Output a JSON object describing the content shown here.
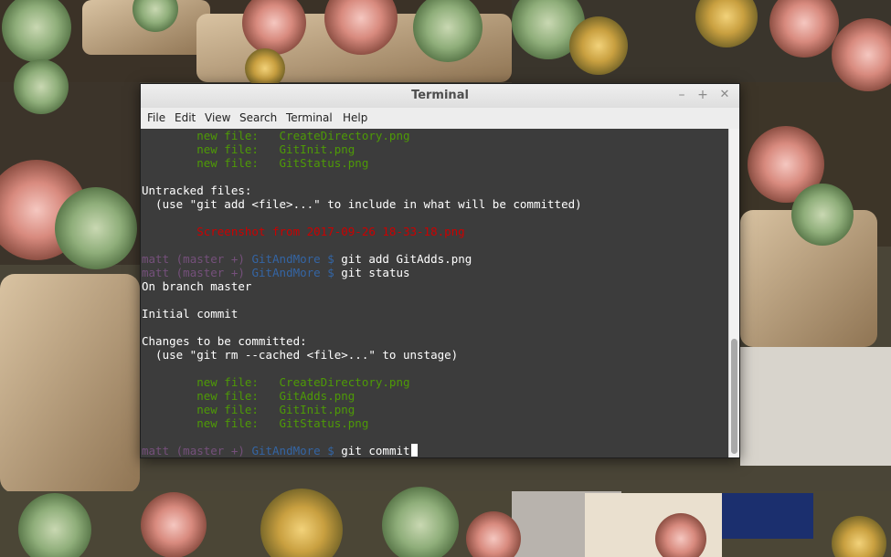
{
  "window": {
    "title": "Terminal",
    "controls": {
      "minimize": "–",
      "maximize": "+",
      "close": "✕"
    }
  },
  "menu": [
    "File",
    "Edit",
    "View",
    "Search",
    "Terminal",
    "Help"
  ],
  "terminal": {
    "lines": [
      [
        {
          "t": "        new file:   CreateDirectory.png",
          "c": "g"
        }
      ],
      [
        {
          "t": "        new file:   GitInit.png",
          "c": "g"
        }
      ],
      [
        {
          "t": "        new file:   GitStatus.png",
          "c": "g"
        }
      ],
      [
        {
          "t": "",
          "c": "w"
        }
      ],
      [
        {
          "t": "Untracked files:",
          "c": "w"
        }
      ],
      [
        {
          "t": "  (use \"git add <file>...\" to include in what will be committed)",
          "c": "w"
        }
      ],
      [
        {
          "t": "",
          "c": "w"
        }
      ],
      [
        {
          "t": "        Screenshot from 2017-09-26 18-33-18.png",
          "c": "r"
        }
      ],
      [
        {
          "t": "",
          "c": "w"
        }
      ],
      [
        {
          "t": "matt ",
          "c": "p"
        },
        {
          "t": "(master +) ",
          "c": "p"
        },
        {
          "t": "GitAndMore $ ",
          "c": "b"
        },
        {
          "t": "git add GitAdds.png",
          "c": "w"
        }
      ],
      [
        {
          "t": "matt ",
          "c": "p"
        },
        {
          "t": "(master +) ",
          "c": "p"
        },
        {
          "t": "GitAndMore $ ",
          "c": "b"
        },
        {
          "t": "git status",
          "c": "w"
        }
      ],
      [
        {
          "t": "On branch master",
          "c": "w"
        }
      ],
      [
        {
          "t": "",
          "c": "w"
        }
      ],
      [
        {
          "t": "Initial commit",
          "c": "w"
        }
      ],
      [
        {
          "t": "",
          "c": "w"
        }
      ],
      [
        {
          "t": "Changes to be committed:",
          "c": "w"
        }
      ],
      [
        {
          "t": "  (use \"git rm --cached <file>...\" to unstage)",
          "c": "w"
        }
      ],
      [
        {
          "t": "",
          "c": "w"
        }
      ],
      [
        {
          "t": "        new file:   CreateDirectory.png",
          "c": "g"
        }
      ],
      [
        {
          "t": "        new file:   GitAdds.png",
          "c": "g"
        }
      ],
      [
        {
          "t": "        new file:   GitInit.png",
          "c": "g"
        }
      ],
      [
        {
          "t": "        new file:   GitStatus.png",
          "c": "g"
        }
      ],
      [
        {
          "t": "",
          "c": "w"
        }
      ],
      [
        {
          "t": "matt ",
          "c": "p"
        },
        {
          "t": "(master +) ",
          "c": "p"
        },
        {
          "t": "GitAndMore $ ",
          "c": "b"
        },
        {
          "t": "git commit",
          "c": "w"
        }
      ]
    ],
    "colors": {
      "background": "#3c3c3c",
      "green": "#4e9a06",
      "red": "#cc0000",
      "purple": "#75507b",
      "blue": "#3465a4",
      "foreground": "#ffffff"
    },
    "scroll_position": 0.62,
    "scroll_visible_fraction": 0.35
  }
}
